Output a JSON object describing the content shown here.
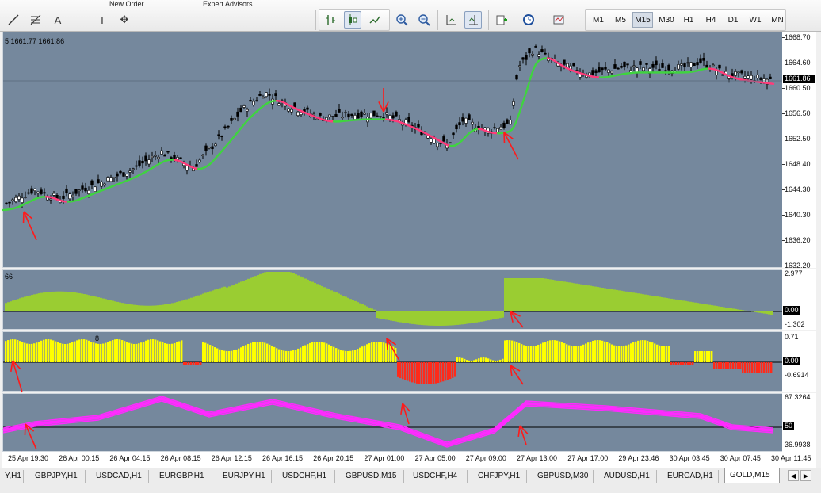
{
  "toolbar": {
    "cut_labels": [
      "New Order",
      "Expert Advisors"
    ],
    "timeframes": [
      "M1",
      "M5",
      "M15",
      "M30",
      "H1",
      "H4",
      "D1",
      "W1",
      "MN"
    ],
    "active_timeframe": "M15",
    "icons": [
      "line-icon",
      "fibonacci-icon",
      "text-icon",
      "label-icon",
      "objects-icon",
      "bar-chart-icon",
      "candlestick-icon",
      "line-chart-icon",
      "zoom-in-icon",
      "zoom-out-icon",
      "autoscroll-icon",
      "chart-shift-icon",
      "indicators-icon",
      "periods-icon",
      "templates-icon"
    ]
  },
  "main_pane": {
    "info": "5 1661.77 1661.86",
    "price_labels": [
      "1668.70",
      "1664.60",
      "1660.50",
      "1656.50",
      "1652.50",
      "1648.40",
      "1644.30",
      "1640.30",
      "1636.20",
      "1632.20"
    ],
    "current_price": "1661.86",
    "colors": {
      "background": "#75889d",
      "ma_up": "#3fd43f",
      "ma_down": "#ff3b7a",
      "arrow": "#ff1a1a"
    }
  },
  "pane2": {
    "info": "66",
    "labels": [
      "2.977",
      "0.00",
      "-1.302"
    ],
    "color": "#9acd32"
  },
  "pane3": {
    "info": "8",
    "labels": [
      "0.71",
      "0.00",
      "-0.6914"
    ],
    "color_up": "#ffff00",
    "color_down": "#ff2a1a"
  },
  "pane4": {
    "labels": [
      "67.3264",
      "50",
      "36.9938"
    ],
    "color": "#ff2aff"
  },
  "time_labels": [
    "25 Apr 19:30",
    "26 Apr 00:15",
    "26 Apr 04:15",
    "26 Apr 08:15",
    "26 Apr 12:15",
    "26 Apr 16:15",
    "26 Apr 20:15",
    "27 Apr 01:00",
    "27 Apr 05:00",
    "27 Apr 09:00",
    "27 Apr 13:00",
    "27 Apr 17:00",
    "29 Apr 23:46",
    "30 Apr 03:45",
    "30 Apr 07:45",
    "30 Apr 11:45"
  ],
  "tabs": [
    "Y,H1",
    "GBPJPY,H1",
    "USDCAD,H1",
    "EURGBP,H1",
    "EURJPY,H1",
    "USDCHF,H1",
    "GBPUSD,M15",
    "USDCHF,H4",
    "CHFJPY,H1",
    "GBPUSD,M30",
    "AUDUSD,H1",
    "EURCAD,H1",
    "GOLD,M15"
  ],
  "active_tab": "GOLD,M15",
  "tab_arrows": [
    "◀",
    "▶"
  ]
}
